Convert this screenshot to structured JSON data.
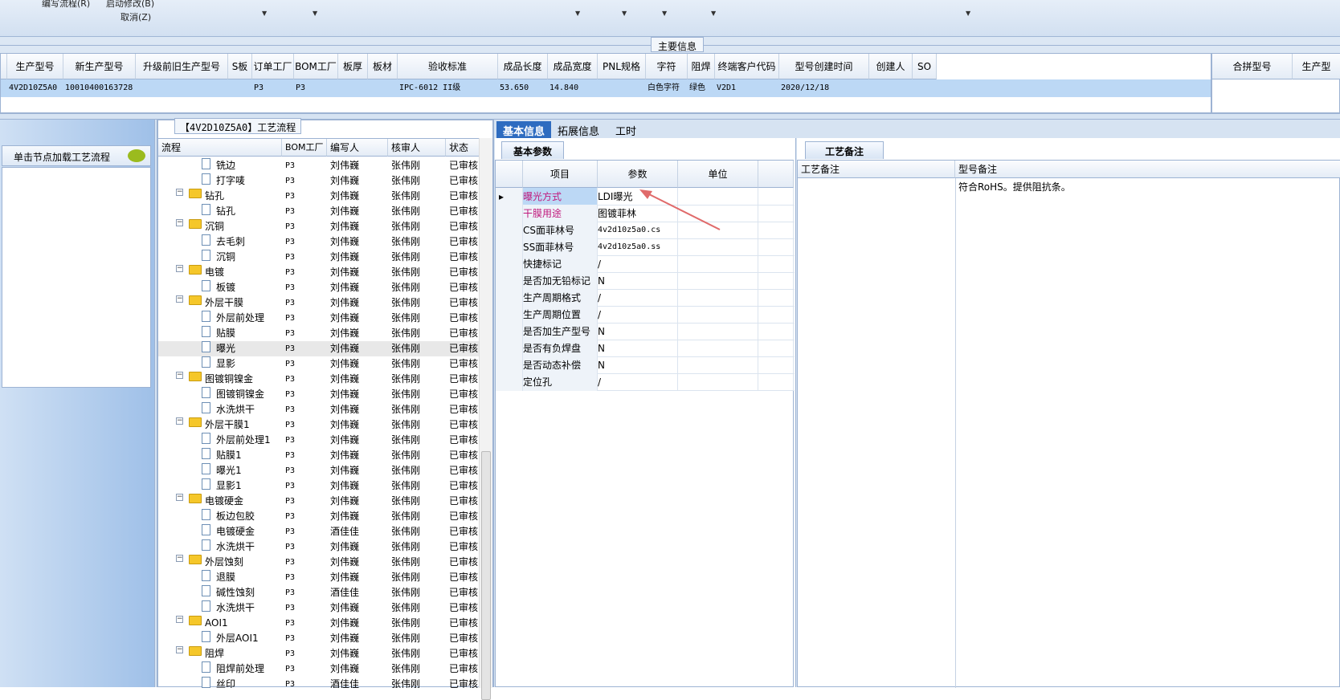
{
  "toolbar": {
    "edit_flow": "编写流程(R)",
    "start_modify": "启动修改(B)",
    "cancel": "取消(Z)"
  },
  "main_info": {
    "title": "主要信息",
    "columns": [
      "生产型号",
      "新生产型号",
      "升级前旧生产型号",
      "S板",
      "订单工厂",
      "BOM工厂",
      "板厚",
      "板材",
      "验收标准",
      "成品长度",
      "成品宽度",
      "PNL规格",
      "字符",
      "阻焊",
      "终端客户代码",
      "型号创建时间",
      "创建人",
      "SO"
    ],
    "row": [
      "4V2D10Z5A0",
      "10010400163728",
      "",
      "",
      "P3",
      "P3",
      "",
      "",
      "IPC-6012 II级",
      "53.650",
      "14.840",
      "",
      "白色字符",
      "绿色",
      "V2D1",
      "2020/12/18",
      "",
      ""
    ],
    "right_columns": [
      "合拼型号",
      "生产型"
    ]
  },
  "left_panel": {
    "header": "单击节点加载工艺流程"
  },
  "process": {
    "title": "【4V2D10Z5A0】工艺流程",
    "columns": [
      "流程",
      "BOM工厂",
      "编写人",
      "核审人",
      "状态"
    ],
    "rows": [
      {
        "name": "铣边",
        "level": 1,
        "bom": "P3",
        "writer": "刘伟巍",
        "reviewer": "张伟刚",
        "status": "已审核"
      },
      {
        "name": "打字唛",
        "level": 1,
        "bom": "P3",
        "writer": "刘伟巍",
        "reviewer": "张伟刚",
        "status": "已审核"
      },
      {
        "name": "钻孔",
        "level": 0,
        "bom": "P3",
        "writer": "刘伟巍",
        "reviewer": "张伟刚",
        "status": "已审核"
      },
      {
        "name": "钻孔",
        "level": 1,
        "bom": "P3",
        "writer": "刘伟巍",
        "reviewer": "张伟刚",
        "status": "已审核"
      },
      {
        "name": "沉铜",
        "level": 0,
        "bom": "P3",
        "writer": "刘伟巍",
        "reviewer": "张伟刚",
        "status": "已审核"
      },
      {
        "name": "去毛刺",
        "level": 1,
        "bom": "P3",
        "writer": "刘伟巍",
        "reviewer": "张伟刚",
        "status": "已审核"
      },
      {
        "name": "沉铜",
        "level": 1,
        "bom": "P3",
        "writer": "刘伟巍",
        "reviewer": "张伟刚",
        "status": "已审核"
      },
      {
        "name": "电镀",
        "level": 0,
        "bom": "P3",
        "writer": "刘伟巍",
        "reviewer": "张伟刚",
        "status": "已审核"
      },
      {
        "name": "板镀",
        "level": 1,
        "bom": "P3",
        "writer": "刘伟巍",
        "reviewer": "张伟刚",
        "status": "已审核"
      },
      {
        "name": "外层干膜",
        "level": 0,
        "bom": "P3",
        "writer": "刘伟巍",
        "reviewer": "张伟刚",
        "status": "已审核"
      },
      {
        "name": "外层前处理",
        "level": 1,
        "bom": "P3",
        "writer": "刘伟巍",
        "reviewer": "张伟刚",
        "status": "已审核"
      },
      {
        "name": "贴膜",
        "level": 1,
        "bom": "P3",
        "writer": "刘伟巍",
        "reviewer": "张伟刚",
        "status": "已审核"
      },
      {
        "name": "曝光",
        "level": 1,
        "bom": "P3",
        "writer": "刘伟巍",
        "reviewer": "张伟刚",
        "status": "已审核",
        "selected": true
      },
      {
        "name": "显影",
        "level": 1,
        "bom": "P3",
        "writer": "刘伟巍",
        "reviewer": "张伟刚",
        "status": "已审核"
      },
      {
        "name": "图镀铜镍金",
        "level": 0,
        "bom": "P3",
        "writer": "刘伟巍",
        "reviewer": "张伟刚",
        "status": "已审核"
      },
      {
        "name": "图镀铜镍金",
        "level": 1,
        "bom": "P3",
        "writer": "刘伟巍",
        "reviewer": "张伟刚",
        "status": "已审核"
      },
      {
        "name": "水洗烘干",
        "level": 1,
        "bom": "P3",
        "writer": "刘伟巍",
        "reviewer": "张伟刚",
        "status": "已审核"
      },
      {
        "name": "外层干膜1",
        "level": 0,
        "bom": "P3",
        "writer": "刘伟巍",
        "reviewer": "张伟刚",
        "status": "已审核"
      },
      {
        "name": "外层前处理1",
        "level": 1,
        "bom": "P3",
        "writer": "刘伟巍",
        "reviewer": "张伟刚",
        "status": "已审核"
      },
      {
        "name": "贴膜1",
        "level": 1,
        "bom": "P3",
        "writer": "刘伟巍",
        "reviewer": "张伟刚",
        "status": "已审核"
      },
      {
        "name": "曝光1",
        "level": 1,
        "bom": "P3",
        "writer": "刘伟巍",
        "reviewer": "张伟刚",
        "status": "已审核"
      },
      {
        "name": "显影1",
        "level": 1,
        "bom": "P3",
        "writer": "刘伟巍",
        "reviewer": "张伟刚",
        "status": "已审核"
      },
      {
        "name": "电镀硬金",
        "level": 0,
        "bom": "P3",
        "writer": "刘伟巍",
        "reviewer": "张伟刚",
        "status": "已审核"
      },
      {
        "name": "板边包胶",
        "level": 1,
        "bom": "P3",
        "writer": "刘伟巍",
        "reviewer": "张伟刚",
        "status": "已审核"
      },
      {
        "name": "电镀硬金",
        "level": 1,
        "bom": "P3",
        "writer": "酒佳佳",
        "reviewer": "张伟刚",
        "status": "已审核"
      },
      {
        "name": "水洗烘干",
        "level": 1,
        "bom": "P3",
        "writer": "刘伟巍",
        "reviewer": "张伟刚",
        "status": "已审核"
      },
      {
        "name": "外层蚀刻",
        "level": 0,
        "bom": "P3",
        "writer": "刘伟巍",
        "reviewer": "张伟刚",
        "status": "已审核"
      },
      {
        "name": "退膜",
        "level": 1,
        "bom": "P3",
        "writer": "刘伟巍",
        "reviewer": "张伟刚",
        "status": "已审核"
      },
      {
        "name": "碱性蚀刻",
        "level": 1,
        "bom": "P3",
        "writer": "酒佳佳",
        "reviewer": "张伟刚",
        "status": "已审核"
      },
      {
        "name": "水洗烘干",
        "level": 1,
        "bom": "P3",
        "writer": "刘伟巍",
        "reviewer": "张伟刚",
        "status": "已审核"
      },
      {
        "name": "AOI1",
        "level": 0,
        "bom": "P3",
        "writer": "刘伟巍",
        "reviewer": "张伟刚",
        "status": "已审核"
      },
      {
        "name": "外层AOI1",
        "level": 1,
        "bom": "P3",
        "writer": "刘伟巍",
        "reviewer": "张伟刚",
        "status": "已审核"
      },
      {
        "name": "阻焊",
        "level": 0,
        "bom": "P3",
        "writer": "刘伟巍",
        "reviewer": "张伟刚",
        "status": "已审核"
      },
      {
        "name": "阻焊前处理",
        "level": 1,
        "bom": "P3",
        "writer": "刘伟巍",
        "reviewer": "张伟刚",
        "status": "已审核"
      },
      {
        "name": "丝印",
        "level": 1,
        "bom": "P3",
        "writer": "酒佳佳",
        "reviewer": "张伟刚",
        "status": "已审核"
      }
    ]
  },
  "tabs": [
    "基本信息",
    "拓展信息",
    "工时"
  ],
  "basic_params": {
    "title": "基本参数",
    "columns": [
      "项目",
      "参数",
      "单位"
    ],
    "rows": [
      {
        "key": "曝光方式",
        "value": "LDI曝光",
        "unit": "",
        "highlight": true
      },
      {
        "key": "干膜用途",
        "value": "图镀菲林",
        "unit": "",
        "highlight": true
      },
      {
        "key": "CS面菲林号",
        "value": "4v2d10z5a0.cs",
        "unit": ""
      },
      {
        "key": "SS面菲林号",
        "value": "4v2d10z5a0.ss",
        "unit": ""
      },
      {
        "key": "快捷标记",
        "value": "/",
        "unit": ""
      },
      {
        "key": "是否加无铅标记",
        "value": "N",
        "unit": ""
      },
      {
        "key": "生产周期格式",
        "value": "/",
        "unit": ""
      },
      {
        "key": "生产周期位置",
        "value": "/",
        "unit": ""
      },
      {
        "key": "是否加生产型号",
        "value": "N",
        "unit": ""
      },
      {
        "key": "是否有负焊盘",
        "value": "N",
        "unit": ""
      },
      {
        "key": "是否动态补偿",
        "value": "N",
        "unit": ""
      },
      {
        "key": "定位孔",
        "value": "/",
        "unit": ""
      }
    ]
  },
  "process_notes": {
    "title": "工艺备注",
    "col1": "工艺备注",
    "col2": "型号备注",
    "model_note": "符合RoHS。提供阻抗条。"
  },
  "colors": {
    "accent": "#2e6cc0",
    "highlight_text": "#c0187c",
    "selection": "#bcd8f5",
    "arrow": "#e06a6a"
  }
}
